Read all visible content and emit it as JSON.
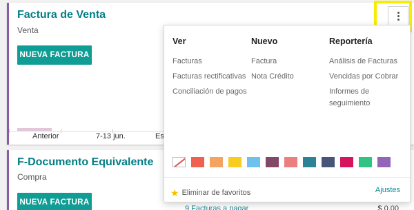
{
  "card1": {
    "title": "Factura de Venta",
    "subtitle": "Venta",
    "button_label": "NUEVA FACTURA",
    "chart_labels": [
      "Anterior",
      "7-13 jun.",
      "Est"
    ]
  },
  "card2": {
    "title": "F-Documento Equivalente",
    "subtitle": "Compra",
    "button_label": "NUEVA FACTURA",
    "footer_link": "9 Facturas a pagar",
    "footer_amount": "$ 0,00"
  },
  "dropdown": {
    "columns": [
      {
        "heading": "Ver",
        "items": [
          "Facturas",
          "Facturas rectificativas",
          "Conciliación de pagos"
        ]
      },
      {
        "heading": "Nuevo",
        "items": [
          "Factura",
          "Nota Crédito"
        ]
      },
      {
        "heading": "Reportería",
        "items": [
          "Análisis de Facturas",
          "Vencidas por Cobrar",
          "Informes de seguimiento"
        ]
      }
    ],
    "colors": [
      "#f06050",
      "#f4a460",
      "#f7cd1f",
      "#6cc1ed",
      "#814968",
      "#eb7e7f",
      "#2c8397",
      "#475577",
      "#d6145f",
      "#30c381",
      "#9365b8"
    ],
    "favorite_label": "Eliminar de favoritos",
    "favorite_icon": "star-icon",
    "settings_label": "Ajustes"
  },
  "kebab_icon": "vertical-ellipsis-icon"
}
